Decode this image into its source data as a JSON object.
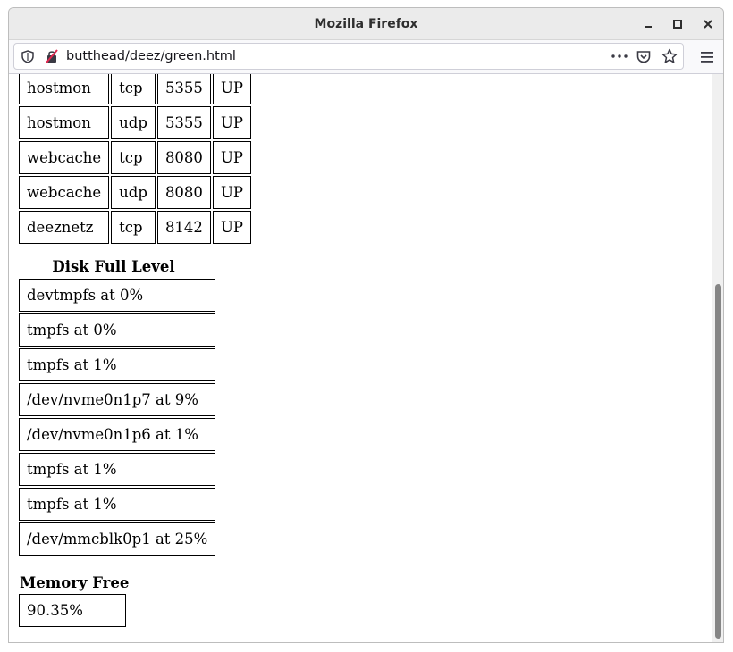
{
  "window": {
    "title": "Mozilla Firefox",
    "minimize_icon": "minimize-icon",
    "maximize_icon": "maximize-icon",
    "close_icon": "close-icon"
  },
  "toolbar": {
    "url": "butthead/deez/green.html",
    "icons": [
      "shield-icon",
      "insecure-lock-icon",
      "more-icon",
      "pocket-icon",
      "bookmark-star-icon",
      "menu-icon"
    ]
  },
  "ports_table": {
    "rows": [
      [
        "hostmon",
        "tcp",
        "5355",
        "UP"
      ],
      [
        "hostmon",
        "udp",
        "5355",
        "UP"
      ],
      [
        "webcache",
        "tcp",
        "8080",
        "UP"
      ],
      [
        "webcache",
        "udp",
        "8080",
        "UP"
      ],
      [
        "deeznetz",
        "tcp",
        "8142",
        "UP"
      ]
    ]
  },
  "disk": {
    "caption": "Disk Full Level",
    "rows": [
      "devtmpfs at 0%",
      "tmpfs at 0%",
      "tmpfs at 1%",
      "/dev/nvme0n1p7 at 9%",
      "/dev/nvme0n1p6 at 1%",
      "tmpfs at 1%",
      "tmpfs at 1%",
      "/dev/mmcblk0p1 at 25%"
    ]
  },
  "memory": {
    "caption": "Memory Free",
    "value": "90.35%"
  }
}
